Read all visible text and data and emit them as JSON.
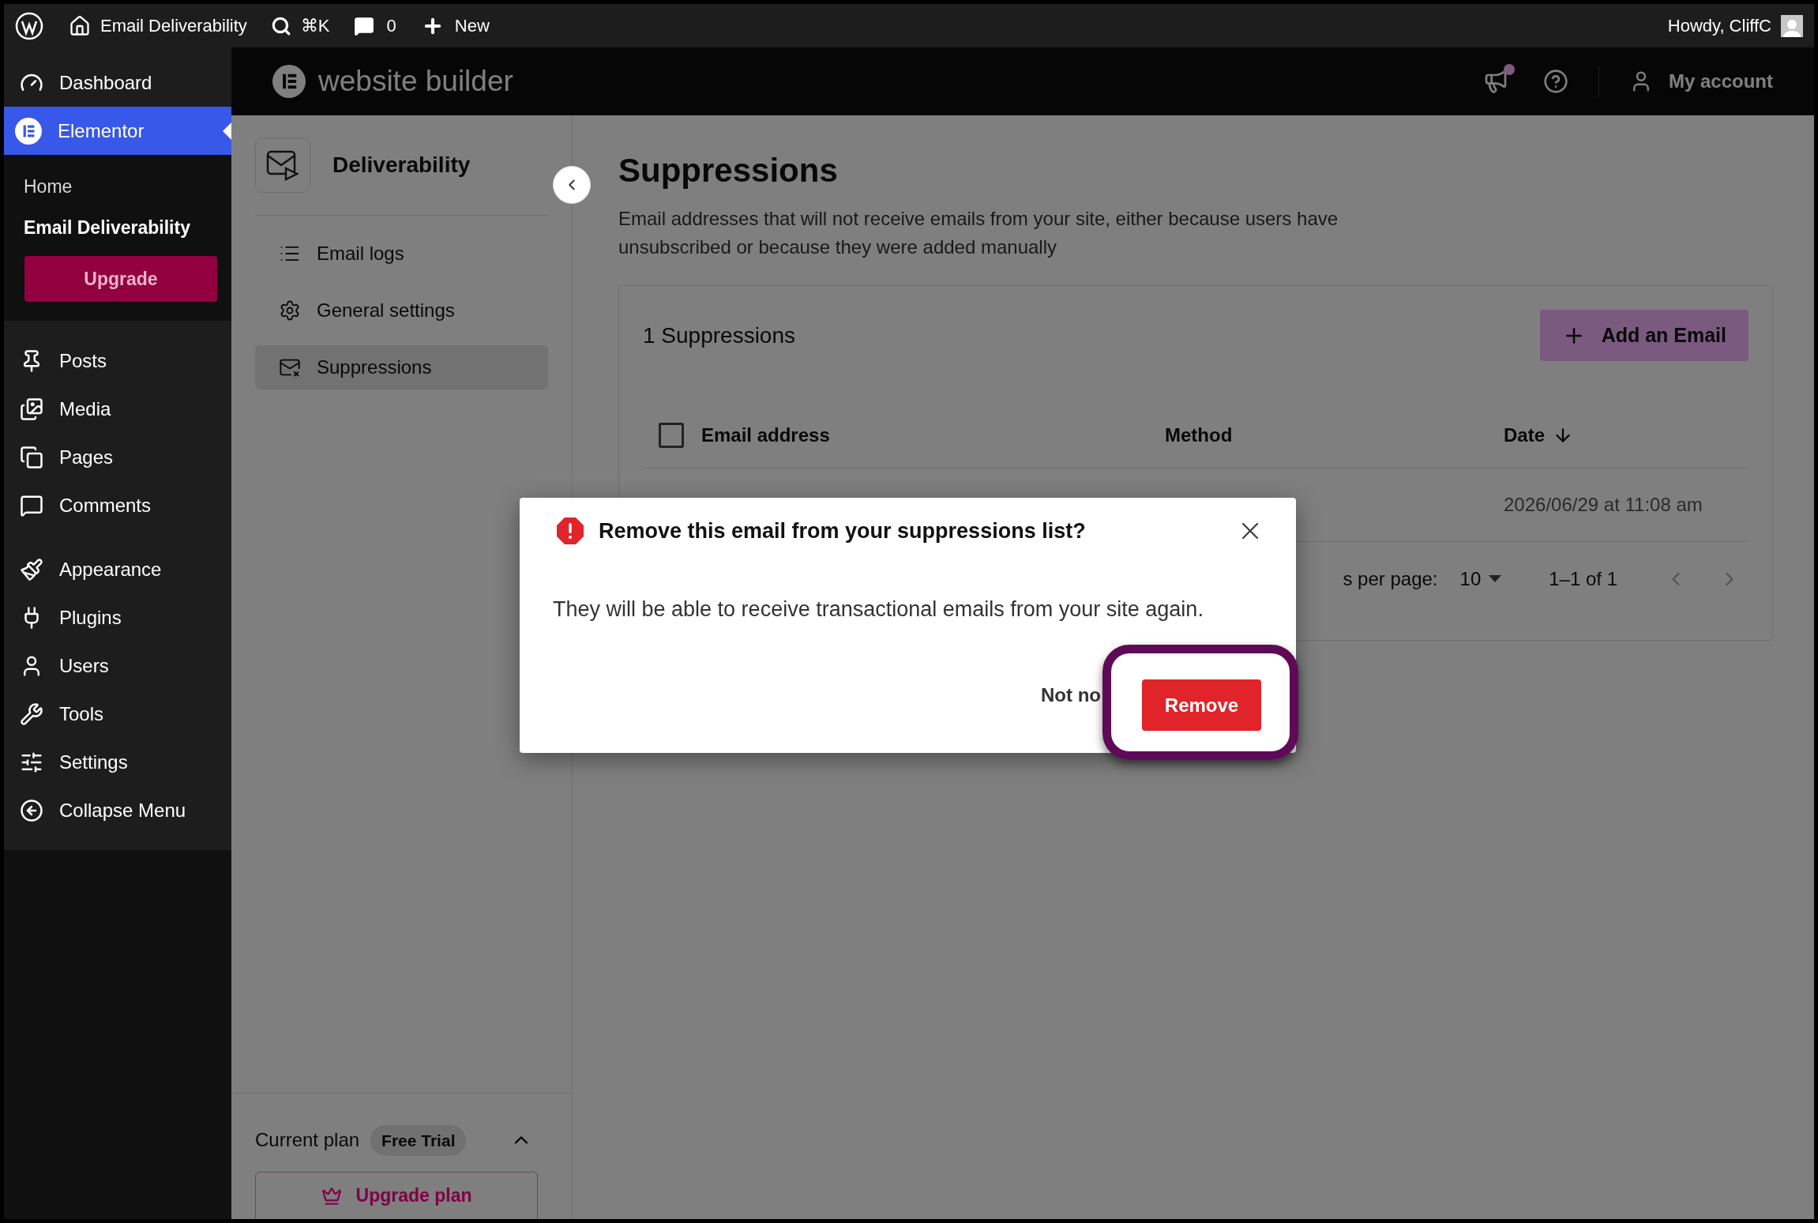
{
  "admin_bar": {
    "site": "Email Deliverability",
    "shortcut": "⌘K",
    "comments": "0",
    "new": "New",
    "greeting": "Howdy, CliffC"
  },
  "admin_menu": [
    {
      "label": "Dashboard",
      "selected": false
    },
    {
      "label": "Elementor",
      "selected": true,
      "children": [
        {
          "label": "Home",
          "selected": false
        },
        {
          "label": "Email Deliverability",
          "selected": true
        }
      ],
      "upgrade": "Upgrade"
    },
    {
      "label": "Posts",
      "selected": false
    },
    {
      "label": "Media",
      "selected": false
    },
    {
      "label": "Pages",
      "selected": false
    },
    {
      "label": "Comments",
      "selected": false
    },
    {
      "label": "Appearance",
      "selected": false
    },
    {
      "label": "Plugins",
      "selected": false
    },
    {
      "label": "Users",
      "selected": false
    },
    {
      "label": "Tools",
      "selected": false
    },
    {
      "label": "Settings",
      "selected": false
    },
    {
      "label": "Collapse Menu",
      "selected": false
    }
  ],
  "app_header": {
    "brand": "website builder",
    "unread": true,
    "account": "My account"
  },
  "plugin_nav": {
    "title": "Deliverability",
    "items": [
      {
        "label": "Email logs",
        "selected": false
      },
      {
        "label": "General settings",
        "selected": false
      },
      {
        "label": "Suppressions",
        "selected": true
      }
    ],
    "plan": {
      "label": "Current plan",
      "badge": "Free Trial",
      "button": "Upgrade plan"
    }
  },
  "page": {
    "title": "Suppressions",
    "description": "Email addresses that will not receive emails from your site, either because users have unsubscribed or because they were added manually",
    "card": {
      "count": "1 Suppressions",
      "add_button": "Add an Email",
      "select_all": false,
      "columns": [
        "Email address",
        "Method",
        "Date"
      ],
      "rows": [
        {
          "date": "2026/06/29 at 11:08 am"
        }
      ],
      "pagination": {
        "rows_label": "s per page:",
        "per_page": "10",
        "range": "1–1 of 1"
      }
    }
  },
  "dialog": {
    "title": "Remove this email from your suppressions list?",
    "body": "They will be able to receive transactional emails from your site again.",
    "cancel": "Not no",
    "confirm": "Remove"
  }
}
